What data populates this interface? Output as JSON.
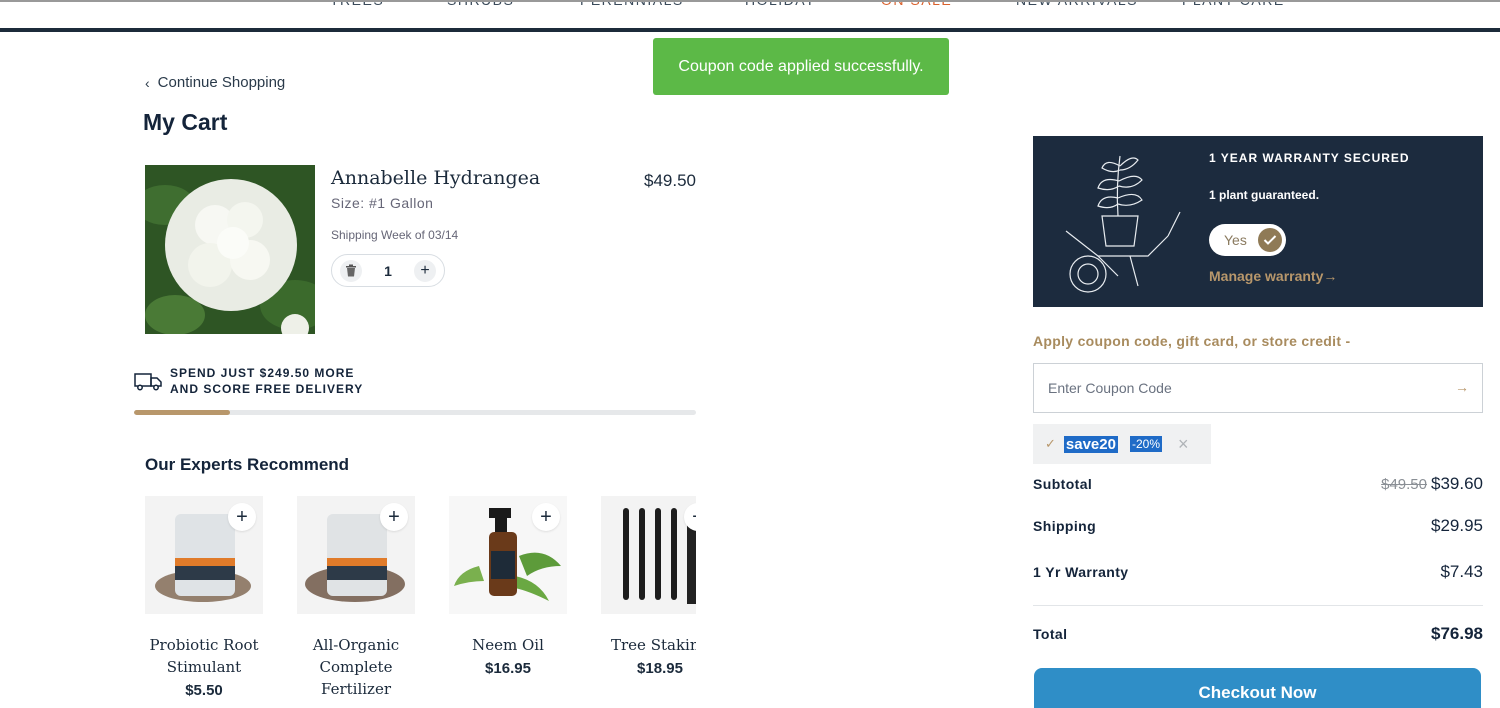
{
  "nav": {
    "items": [
      "TREES",
      "SHRUBS",
      "PERENNIALS",
      "HOLIDAY",
      "ON SALE",
      "NEW ARRIVALS",
      "PLANT CARE"
    ]
  },
  "toast": "Coupon code applied successfully.",
  "continue_shopping": "Continue Shopping",
  "page_title": "My Cart",
  "cart_item": {
    "name": "Annabelle Hydrangea",
    "size": "Size: #1 Gallon",
    "shipping": "Shipping Week of 03/14",
    "price": "$49.50",
    "quantity": "1"
  },
  "delivery": {
    "line1": "SPEND JUST $249.50 MORE",
    "line2": "AND SCORE FREE DELIVERY",
    "progress_fraction": 0.17
  },
  "recommend_title": "Our Experts Recommend",
  "recommendations": [
    {
      "name": "Probiotic Root Stimulant",
      "price": "$5.50"
    },
    {
      "name": "All-Organic Complete Fertilizer",
      "price": ""
    },
    {
      "name": "Neem Oil",
      "price": "$16.95"
    },
    {
      "name": "Tree Staking I",
      "price": "$18.95"
    }
  ],
  "warranty": {
    "title": "1 YEAR WARRANTY SECURED",
    "subtitle": "1 plant guaranteed.",
    "toggle_label": "Yes",
    "manage_link": "Manage warranty"
  },
  "coupon": {
    "label": "Apply coupon code, gift card, or store credit -",
    "placeholder": "Enter Coupon Code",
    "applied_code": "save20",
    "applied_discount": "-20%"
  },
  "summary": {
    "subtotal_label": "Subtotal",
    "subtotal_original": "$49.50",
    "subtotal_value": "$39.60",
    "shipping_label": "Shipping",
    "shipping_value": "$29.95",
    "warranty_label": "1 Yr Warranty",
    "warranty_value": "$7.43",
    "total_label": "Total",
    "total_value": "$76.98"
  },
  "checkout_label": "Checkout Now",
  "colors": {
    "navy": "#1c2b3e",
    "gold": "#b8976b",
    "toast_green": "#5cb947",
    "checkout_blue": "#2f8ec7",
    "sale_orange": "#d9612d"
  }
}
